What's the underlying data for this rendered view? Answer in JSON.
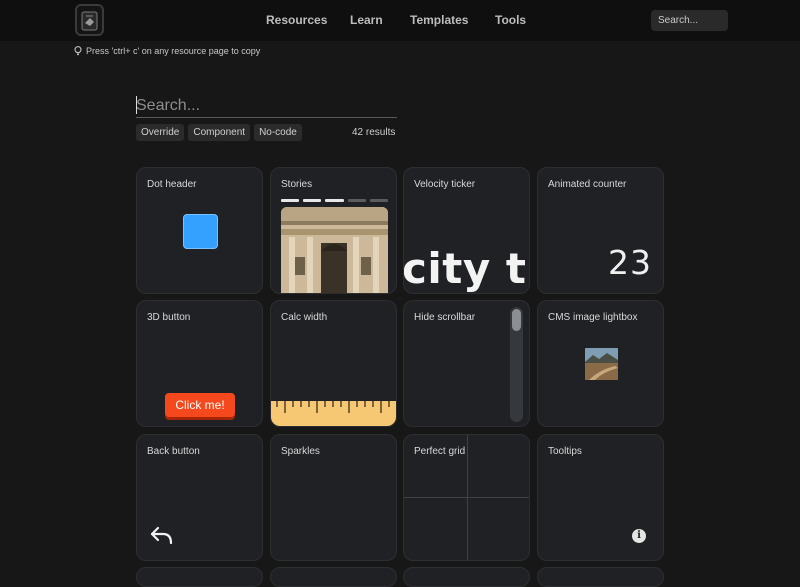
{
  "nav": {
    "items": [
      {
        "label": "Resources"
      },
      {
        "label": "Learn"
      },
      {
        "label": "Templates"
      },
      {
        "label": "Tools"
      }
    ],
    "search_placeholder": "Search..."
  },
  "hint": {
    "text": "Press 'ctrl+ c' on any resource page to copy",
    "icon": "lightbulb-icon"
  },
  "search": {
    "placeholder": "Search..."
  },
  "filters": [
    "Override",
    "Component",
    "No-code"
  ],
  "results": "42 results",
  "cards": [
    {
      "title": "Dot header"
    },
    {
      "title": "Stories"
    },
    {
      "title": "Velocity ticker",
      "ticker_text": "city tic"
    },
    {
      "title": "Animated counter",
      "counter_value": "23"
    },
    {
      "title": "3D button",
      "button_label": "Click me!"
    },
    {
      "title": "Calc width"
    },
    {
      "title": "Hide scrollbar"
    },
    {
      "title": "CMS image lightbox"
    },
    {
      "title": "Back button",
      "icon": "back-arrow-icon"
    },
    {
      "title": "Sparkles"
    },
    {
      "title": "Perfect grid"
    },
    {
      "title": "Tooltips",
      "icon": "info-icon",
      "icon_glyph": "i"
    }
  ],
  "colors": {
    "background": "#171717",
    "card": "#1f2124",
    "accent_blue": "#34a0ff",
    "button_orange": "#f5481c",
    "ruler_yellow": "#f7c873"
  }
}
